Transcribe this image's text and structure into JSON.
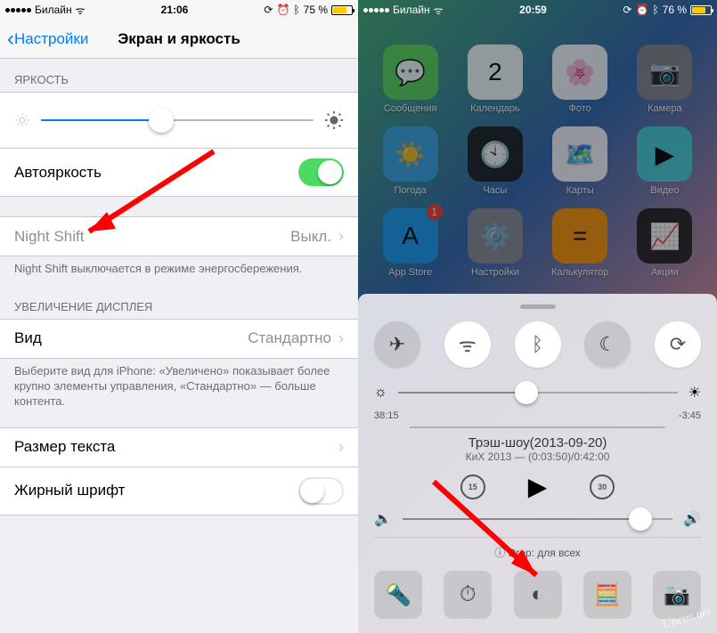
{
  "left_status": {
    "carrier": "Билайн",
    "time": "21:06",
    "battery_pct": "75 %",
    "battery_fill": "75%"
  },
  "right_status": {
    "carrier": "Билайн",
    "time": "20:59",
    "battery_pct": "76 %",
    "battery_fill": "76%"
  },
  "nav": {
    "back": "Настройки",
    "title": "Экран и яркость"
  },
  "settings": {
    "brightness_header": "ЯРКОСТЬ",
    "auto_brightness": "Автояркость",
    "night_shift": "Night Shift",
    "night_shift_value": "Выкл.",
    "night_shift_footer": "Night Shift выключается в режиме энергосбережения.",
    "zoom_header": "УВЕЛИЧЕНИЕ ДИСПЛЕЯ",
    "view": "Вид",
    "view_value": "Стандартно",
    "view_footer": "Выберите вид для iPhone: «Увеличено» показывает более крупно элементы управления, «Стандартно» — больше контента.",
    "text_size": "Размер текста",
    "bold_text": "Жирный шрифт",
    "brightness_slider_pos": "44%"
  },
  "apps": [
    {
      "label": "Сообщения",
      "color": "#5bd35b",
      "glyph": "💬"
    },
    {
      "label": "Календарь",
      "color": "#fff",
      "glyph": "2"
    },
    {
      "label": "Фото",
      "color": "#fff",
      "glyph": "🌸"
    },
    {
      "label": "Камера",
      "color": "#888",
      "glyph": "📷"
    },
    {
      "label": "Погода",
      "color": "#3ba4e8",
      "glyph": "☀️"
    },
    {
      "label": "Часы",
      "color": "#1d1d1d",
      "glyph": "🕙"
    },
    {
      "label": "Карты",
      "color": "#fff",
      "glyph": "🗺️"
    },
    {
      "label": "Видео",
      "color": "#44d1d8",
      "glyph": "▶"
    },
    {
      "label": "App Store",
      "color": "#1d9df4",
      "glyph": "A",
      "badge": "1"
    },
    {
      "label": "Настройки",
      "color": "#8e8e93",
      "glyph": "⚙️"
    },
    {
      "label": "Калькулятор",
      "color": "#ff9500",
      "glyph": "="
    },
    {
      "label": "Акции",
      "color": "#1d1d1d",
      "glyph": "📈"
    }
  ],
  "cc": {
    "brightness_pos": "46%",
    "time_left": "38:15",
    "time_right": "-3:45",
    "track_title": "Трэш-шоу(2013-09-20)",
    "track_sub": "КиХ 2013 — (0:03:50)/0:42:00",
    "skip_back": "15",
    "skip_fwd": "30",
    "airdrop": "Drop: для всех",
    "volume_pos": "88%"
  },
  "watermark": "Uncos.net"
}
